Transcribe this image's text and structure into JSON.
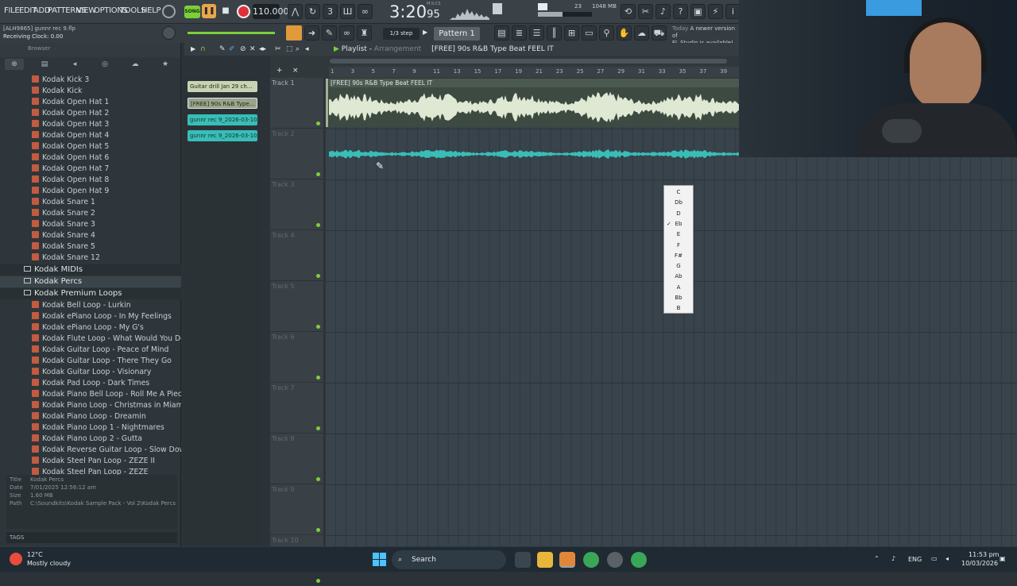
{
  "menu": [
    "FILE",
    "EDIT",
    "ADD",
    "PATTERNS",
    "VIEW",
    "OPTIONS",
    "TOOLS",
    "HELP"
  ],
  "transport": {
    "song_label": "SONG",
    "tempo": "110.000",
    "time_main": "3:20",
    "time_frac": "95",
    "time_mode": "M:S:CS"
  },
  "perf": {
    "poly": "23",
    "poly2": "1",
    "memory": "1048 MB"
  },
  "hint": {
    "project_line": "[ALH9865] gunnr rec 9.flp",
    "status_line": "Receiving Clock: 0.00"
  },
  "toolbar2": {
    "step": "1/3 step",
    "pattern": "Pattern 1"
  },
  "update_notice": {
    "date": "Today",
    "line1": "A newer version of",
    "line2": "FL Studio is available!"
  },
  "browser": {
    "header": "Browser",
    "files_top": [
      "Kodak Kick 3",
      "Kodak Kick",
      "Kodak Open Hat 1",
      "Kodak Open Hat 2",
      "Kodak Open Hat 3",
      "Kodak Open Hat 4",
      "Kodak Open Hat 5",
      "Kodak Open Hat 6",
      "Kodak Open Hat 7",
      "Kodak Open Hat 8",
      "Kodak Open Hat 9",
      "Kodak Snare 1",
      "Kodak Snare 2",
      "Kodak Snare 3",
      "Kodak Snare 4",
      "Kodak Snare 5",
      "Kodak Snare 12"
    ],
    "folders": [
      "Kodak MIDIs",
      "Kodak Percs",
      "Kodak Premium Loops"
    ],
    "files_bottom": [
      "Kodak Bell Loop - Lurkin",
      "Kodak ePiano Loop - In My Feelings",
      "Kodak ePiano Loop - My G's",
      "Kodak Flute Loop - What Would You Do",
      "Kodak Guitar Loop - Peace of Mind",
      "Kodak Guitar Loop - There They Go",
      "Kodak Guitar Loop - Visionary",
      "Kodak Pad Loop - Dark Times",
      "Kodak Piano Bell Loop - Roll Me A Piece",
      "Kodak Piano Loop - Christmas in Miami",
      "Kodak Piano Loop - Dreamin",
      "Kodak Piano Loop 1 - Nightmares",
      "Kodak Piano Loop 2 - Gutta",
      "Kodak Reverse Guitar Loop - Slow Down",
      "Kodak Steel Pan Loop - ZEZE II",
      "Kodak Steel Pan Loop - ZEZE"
    ],
    "info": {
      "title_k": "Title",
      "title_v": "Kodak Percs",
      "date_k": "Date",
      "date_v": "7/01/2025 12:56:12 am",
      "size_k": "Size",
      "size_v": "1.60 MB",
      "path_k": "Path",
      "path_v": "C:\\Soundkits\\Kodak Sample Pack - Vol 2\\Kodak Percs"
    },
    "tags": "TAGS"
  },
  "picker": [
    "Guitar drill Jan 29 ch...",
    "[FREE] 90s R&B Type...",
    "gunnr rec 9_2026-03-10...",
    "gunnr rec 9_2026-03-10..."
  ],
  "playlist": {
    "title": "Playlist",
    "sub": "Arrangement",
    "arrangement_clip": "[FREE] 90s R&B Type Beat FEEL IT",
    "bars": [
      "1",
      "3",
      "5",
      "7",
      "9",
      "11",
      "13",
      "15",
      "17",
      "19",
      "21",
      "23",
      "25",
      "27",
      "29",
      "31",
      "33",
      "35",
      "37",
      "39"
    ],
    "tracks": [
      "Track 1",
      "Track 2",
      "Track 3",
      "Track 4",
      "Track 5",
      "Track 6",
      "Track 7",
      "Track 8",
      "Track 9",
      "Track 10"
    ],
    "clip_label": "[FREE] 90s R&B Type Beat FEEL IT"
  },
  "key_menu": {
    "items": [
      "C",
      "Db",
      "D",
      "Eb",
      "E",
      "F",
      "F#",
      "G",
      "Ab",
      "A",
      "Bb",
      "B"
    ],
    "selected": "Eb"
  },
  "taskbar": {
    "temp": "12°C",
    "weather": "Mostly cloudy",
    "search": "Search",
    "lang": "ENG",
    "time": "11:53 pm",
    "date": "10/03/2026"
  },
  "colors": {
    "accent_green": "#7bd03a",
    "audio_clip": "#c9d3b3",
    "teal_clip": "#39bdb7",
    "record": "#e0303a"
  }
}
